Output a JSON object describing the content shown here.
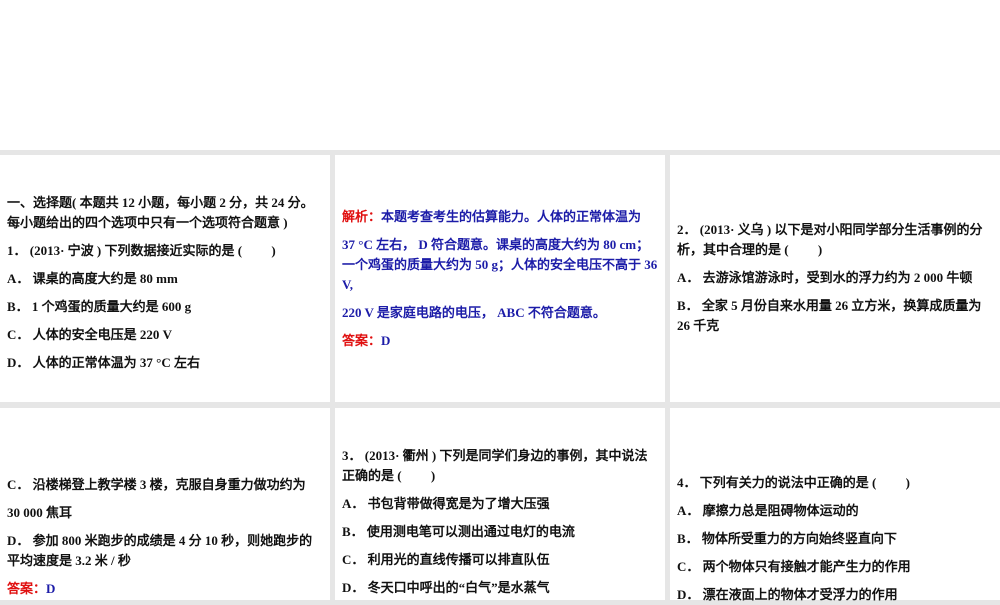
{
  "panels": [
    {
      "section_title": "一、选择题",
      "section_desc": "( 本题共 12 小题，每小题 2 分，共 24 分。每小题给出的四个选项中只有一个选项符合题意 )",
      "question": "1． (2013· 宁波 ) 下列数据接近实际的是 (　　 )",
      "options": [
        "A． 课桌的高度大约是 80 mm",
        "B． 1 个鸡蛋的质量大约是 600 g",
        "C． 人体的安全电压是 220 V",
        "D． 人体的正常体温为 37 °C 左右"
      ]
    },
    {
      "analysis_label": "解析：",
      "analysis": [
        "本题考查考生的估算能力。人体的正常体温为",
        "37 °C 左右， D 符合题意。课桌的高度大约为 80 cm；一个鸡蛋的质量大约为 50 g；人体的安全电压不高于 36 V,",
        "220 V 是家庭电路的电压， ABC 不符合题意。"
      ],
      "answer_label": "答案：",
      "answer": "D"
    },
    {
      "question": "2． (2013· 义乌 ) 以下是对小阳同学部分生活事例的分析，其中合理的是 (　　 )",
      "options": [
        "A． 去游泳馆游泳时，受到水的浮力约为 2 000 牛顿",
        "B． 全家 5 月份自来水用量 26 立方米，换算成质量为 26 千克"
      ]
    },
    {
      "options": [
        "C． 沿楼梯登上教学楼 3 楼，克服自身重力做功约为",
        "30 000 焦耳",
        "D． 参加 800 米跑步的成绩是 4 分 10 秒，则她跑步的平均速度是 3.2 米 / 秒"
      ],
      "answer_label": "答案：",
      "answer": "D"
    },
    {
      "question": "3． (2013· 衢州 ) 下列是同学们身边的事例，其中说法正确的是 (　　 )",
      "options": [
        "A． 书包背带做得宽是为了增大压强",
        "B． 使用测电笔可以测出通过电灯的电流",
        "C． 利用光的直线传播可以排直队伍",
        "D． 冬天口中呼出的“白气”是水蒸气"
      ]
    },
    {
      "question": "4． 下列有关力的说法中正确的是 (　　 )",
      "options": [
        "A． 摩擦力总是阻碍物体运动的",
        "B． 物体所受重力的方向始终竖直向下",
        "C． 两个物体只有接触才能产生力的作用",
        "D． 漂在液面上的物体才受浮力的作用"
      ]
    }
  ]
}
